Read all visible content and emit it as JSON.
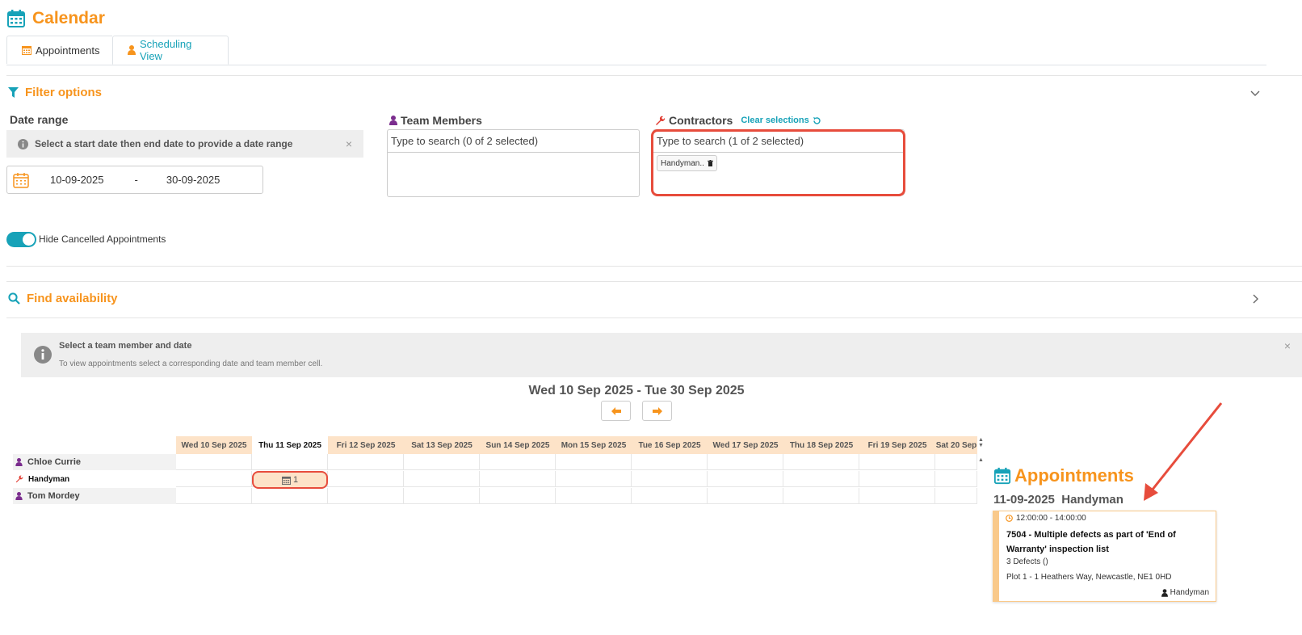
{
  "header": {
    "title": "Calendar",
    "icon": "calendar-icon"
  },
  "tabs": [
    {
      "label": "Appointments",
      "icon": "calendar-icon",
      "active": false
    },
    {
      "label": "Scheduling View",
      "icon": "user-icon",
      "active": true
    }
  ],
  "filter": {
    "title": "Filter options",
    "date_range": {
      "label": "Date range",
      "info": "Select a start date then end date to provide a date range",
      "start": "10-09-2025",
      "separator": "-",
      "end": "30-09-2025"
    },
    "team_members": {
      "label": "Team Members",
      "placeholder": "Type to search (0 of 2 selected)"
    },
    "contractors": {
      "label": "Contractors",
      "clear": "Clear selections",
      "placeholder": "Type to search (1 of 2 selected)",
      "chips": [
        "Handyman.."
      ]
    },
    "toggle": {
      "label": "Hide Cancelled Appointments",
      "on": true
    }
  },
  "availability": {
    "title": "Find availability",
    "info_title": "Select a team member and date",
    "info_desc": "To view appointments select a corresponding date and team member cell."
  },
  "schedule": {
    "range": "Wed 10 Sep 2025 - Tue 30 Sep 2025",
    "columns": [
      "Wed 10 Sep 2025",
      "Thu 11 Sep 2025",
      "Fri 12 Sep 2025",
      "Sat 13 Sep 2025",
      "Sun 14 Sep 2025",
      "Mon 15 Sep 2025",
      "Tue 16 Sep 2025",
      "Wed 17 Sep 2025",
      "Thu 18 Sep 2025",
      "Fri 19 Sep 2025",
      "Sat 20 Sep"
    ],
    "rows": [
      {
        "name": "Chloe Currie",
        "type": "team"
      },
      {
        "name": "Handyman",
        "type": "contractor"
      },
      {
        "name": "Tom Mordey",
        "type": "team"
      }
    ],
    "appointment_cell": {
      "count": "1"
    }
  },
  "appointments_panel": {
    "title": "Appointments",
    "date": "11-09-2025",
    "person": "Handyman",
    "card": {
      "time": "12:00:00 - 14:00:00",
      "title": "7504 - Multiple defects as part of 'End of Warranty' inspection list",
      "defects": "3 Defects ()",
      "address": "Plot 1 - 1 Heathers Way, Newcastle, NE1 0HD",
      "assignee": "Handyman"
    }
  },
  "colors": {
    "accent": "#f7941d",
    "teal": "#17a2b8",
    "highlight": "#e74c3c",
    "cell_bg": "#fde3c8"
  }
}
